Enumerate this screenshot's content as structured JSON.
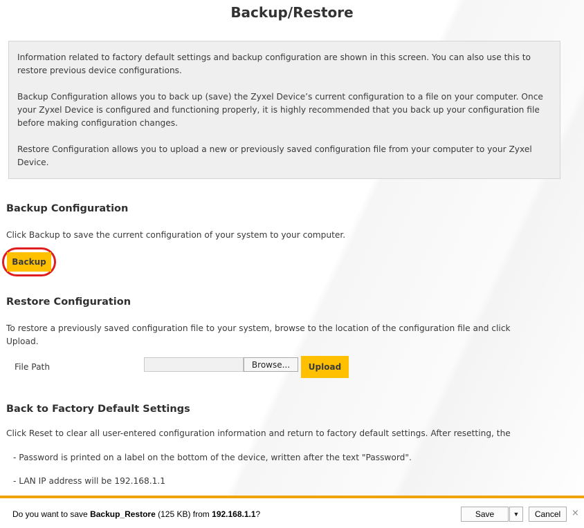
{
  "page": {
    "title": "Backup/Restore"
  },
  "info": {
    "p1": "Information related to factory default settings and backup configuration are shown in this screen. You can also use this to restore previous device configurations.",
    "p2": "Backup Configuration allows you to back up (save) the Zyxel Device’s current configuration to a file on your computer. Once your Zyxel Device is configured and functioning properly, it is highly recommended that you back up your configuration file before making configuration changes.",
    "p3": "Restore Configuration allows you to upload a new or previously saved configuration file from your computer to your Zyxel Device."
  },
  "backup": {
    "title": "Backup Configuration",
    "desc": "Click Backup to save the current configuration of your system to your computer.",
    "button": "Backup"
  },
  "restore": {
    "title": "Restore Configuration",
    "desc": "To restore a previously saved configuration file to your system, browse to the location of the configuration file and click Upload.",
    "file_label": "File Path",
    "file_value": "",
    "browse": "Browse...",
    "upload": "Upload"
  },
  "factory": {
    "title": "Back to Factory Default Settings",
    "desc": "Click Reset to clear all user-entered configuration information and return to factory default settings. After resetting, the",
    "bullet1": "- Password is printed on a label on the bottom of the device, written after the text \"Password\".",
    "bullet2": "- LAN IP address will be 192.168.1.1"
  },
  "download_bar": {
    "prefix": "Do you want to save ",
    "filename": "Backup_Restore",
    "size": " (125 KB) from ",
    "host": "192.168.1.1",
    "suffix": "?",
    "save": "Save",
    "cancel": "Cancel",
    "close": "×",
    "dropdown": "▼"
  },
  "colors": {
    "accent_button": "#ffc000",
    "highlight_ring": "#e01e1e",
    "notification_border": "#f0a30a"
  },
  "icons": {
    "dropdown": "chevron-down-icon",
    "close": "close-icon"
  }
}
